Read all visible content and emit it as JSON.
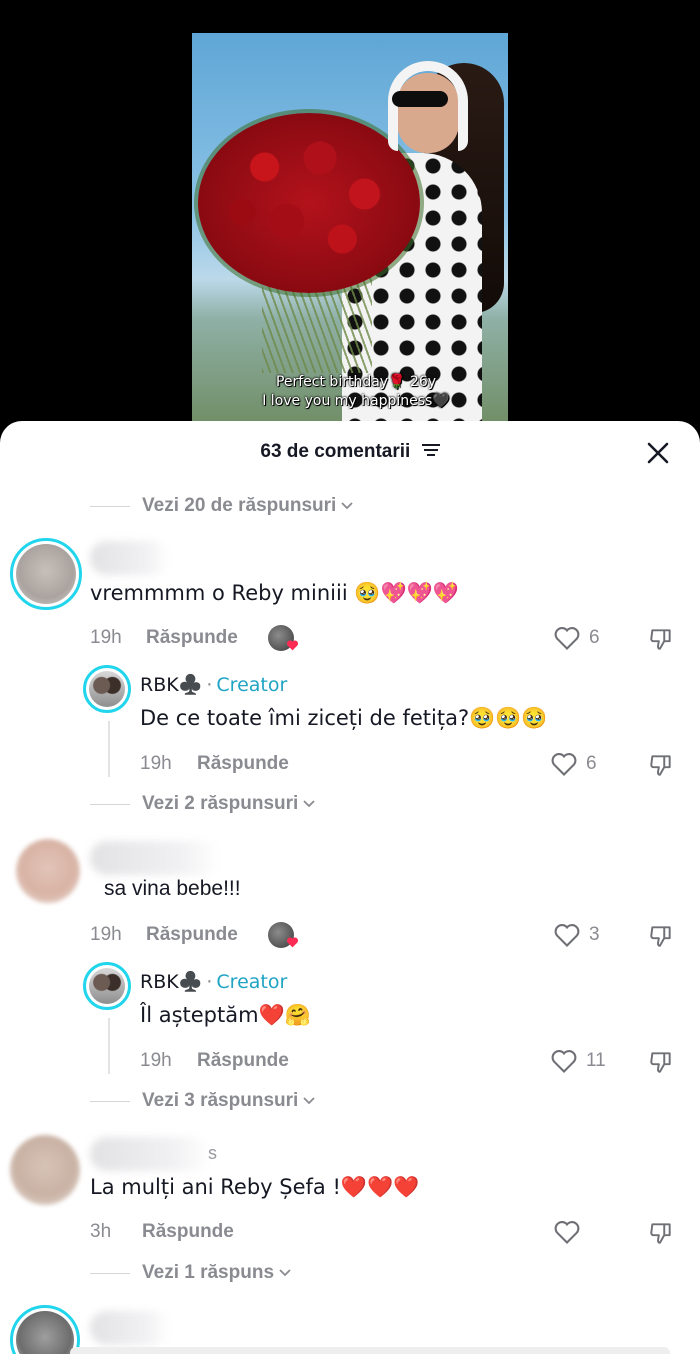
{
  "video": {
    "caption_line1": "Perfect birthday🌹 26y",
    "caption_line2": "I love you my happiness🖤"
  },
  "header": {
    "title": "63 de comentarii",
    "filter_icon": "filter-icon",
    "close_icon": "close-icon"
  },
  "top_replies_link": "Vezi 20 de răspunsuri",
  "comments": [
    {
      "text": "vremmmm o Reby miniii 🥹💖💖💖",
      "time": "19h",
      "reply_label": "Răspunde",
      "likes": "6",
      "creator_reply": {
        "name": "RBK♣️",
        "badge": "Creator",
        "text": "De ce toate îmi ziceți de fetița?🥹🥹🥹",
        "time": "19h",
        "reply_label": "Răspunde",
        "likes": "6"
      },
      "more_replies": "Vezi 2 răspunsuri"
    },
    {
      "text": "sa vina bebe!!!",
      "time": "19h",
      "reply_label": "Răspunde",
      "likes": "3",
      "creator_reply": {
        "name": "RBK♣️",
        "badge": "Creator",
        "text": "Îl așteptăm❤️🤗",
        "time": "19h",
        "reply_label": "Răspunde",
        "likes": "11"
      },
      "more_replies": "Vezi 3 răspunsuri"
    },
    {
      "name_partial": "s",
      "text": "La mulți ani Reby Șefa !❤️❤️❤️",
      "time": "3h",
      "reply_label": "Răspunde",
      "likes": "",
      "more_replies": "Vezi 1 răspuns"
    }
  ],
  "colors": {
    "creator": "#20a4c4",
    "ring": "#20d5ec",
    "muted": "#8a8b91",
    "text": "#161823"
  }
}
